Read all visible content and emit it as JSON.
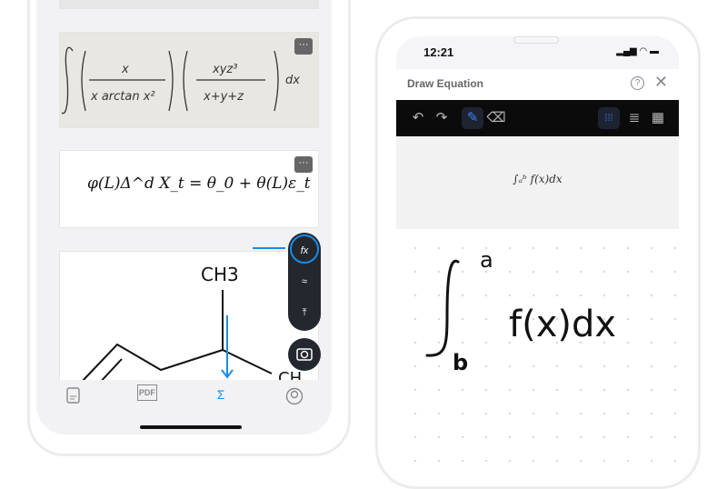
{
  "left_phone": {
    "cards": [
      {
        "type": "handwritten-image",
        "alt_equation": "∫ (x / (x arctan x²)) (xyz³ / (x+y+z)) dx",
        "more_label": "···"
      },
      {
        "type": "rendered",
        "equation": "φ(L)Δ^d X_t = θ_0 + θ(L)ε_t",
        "more_label": "···"
      },
      {
        "type": "handwritten-chemistry",
        "labels": [
          "CH3",
          "CH"
        ]
      }
    ],
    "fab": {
      "items": [
        {
          "icon": "fx-icon",
          "label": "fx"
        },
        {
          "icon": "scribble-icon"
        },
        {
          "icon": "upload-icon"
        }
      ],
      "camera": "camera-icon"
    },
    "tabbar": [
      {
        "icon": "document-icon"
      },
      {
        "icon": "pdf-icon",
        "label": "PDF"
      },
      {
        "icon": "sigma-icon",
        "label": "Σ",
        "active": true
      },
      {
        "icon": "profile-icon"
      }
    ],
    "accent": "#1a8be6"
  },
  "right_phone": {
    "status": {
      "time": "12:21"
    },
    "header": {
      "title": "Draw Equation"
    },
    "toolbar": {
      "tools": [
        "undo",
        "redo",
        "pen",
        "eraser"
      ],
      "backgrounds": [
        "dots",
        "lines",
        "grid"
      ],
      "active_tool": "pen",
      "active_background": "dots"
    },
    "preview": {
      "latex_render": "∫ₐᵇ f(x)dx"
    },
    "canvas": {
      "handwriting": "∫_b^a f(x)dx",
      "upper": "a",
      "lower": "b",
      "body": "f(x)dx"
    }
  }
}
